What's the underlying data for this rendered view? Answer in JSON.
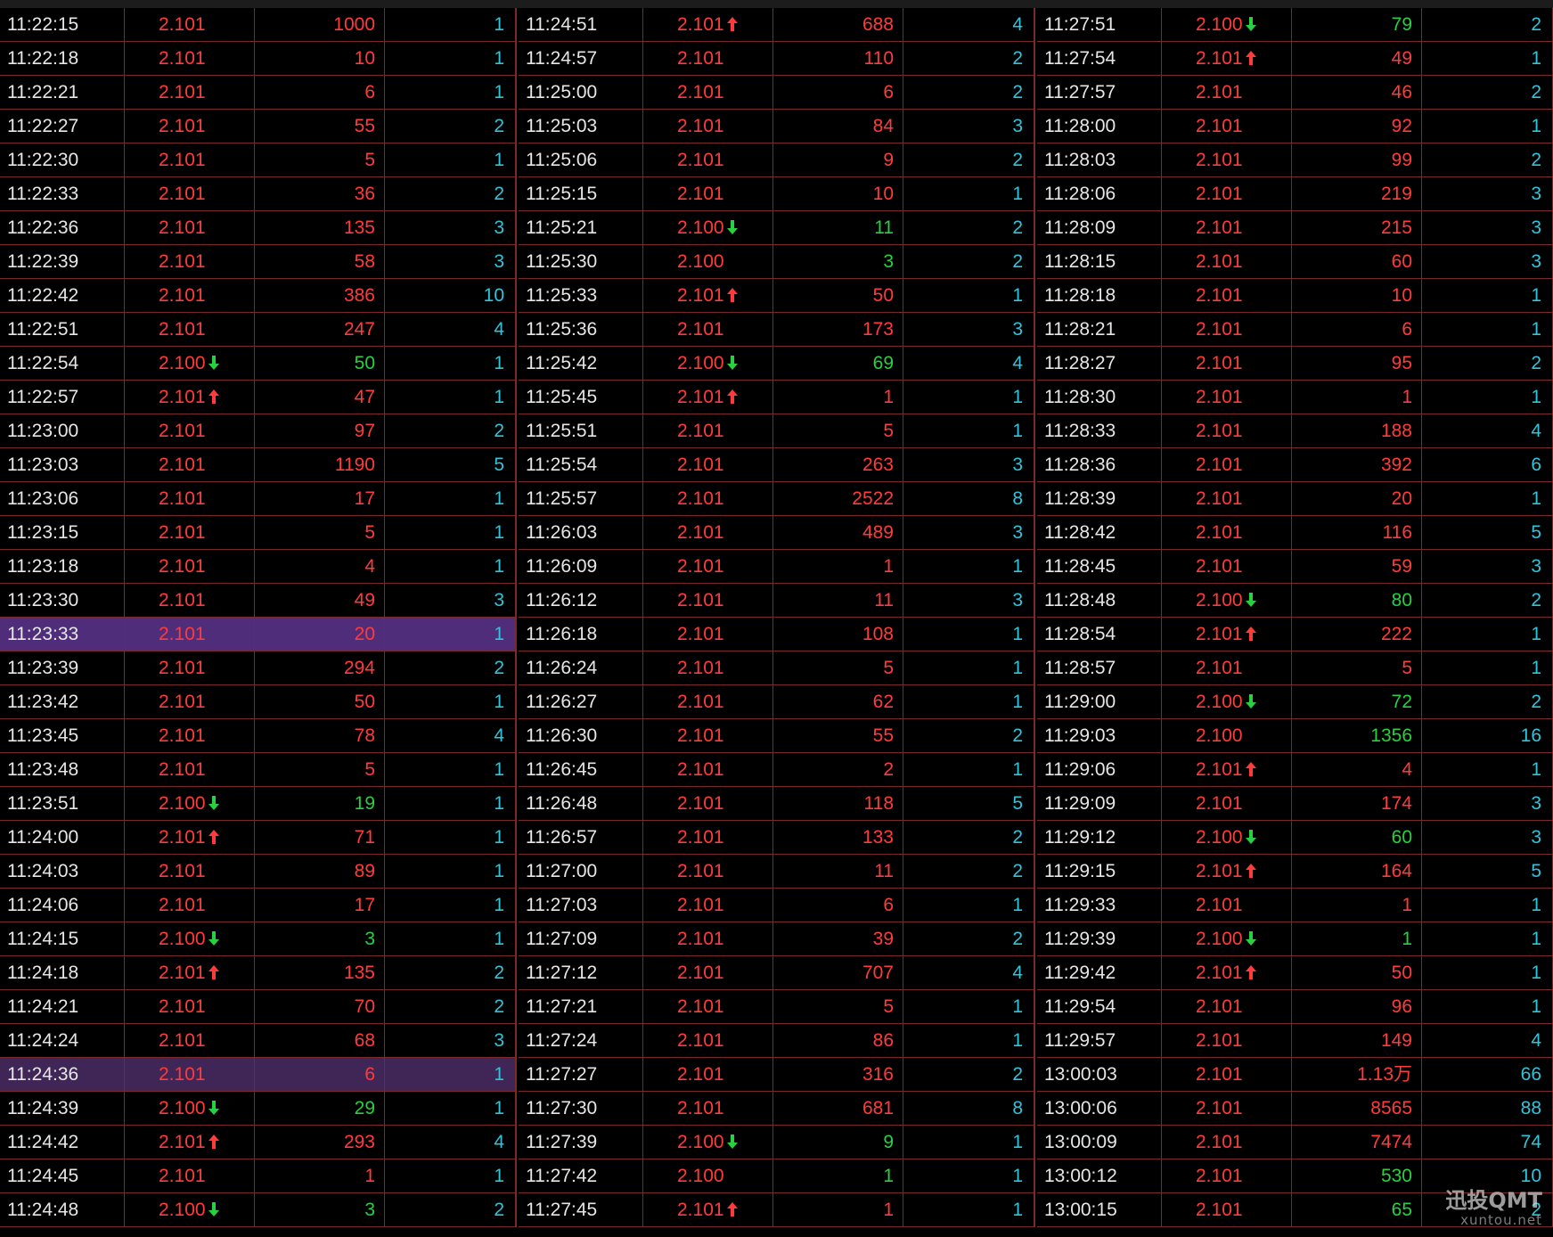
{
  "colors": {
    "up": "#ff3b3b",
    "down": "#27d13f",
    "count": "#2fc4dc",
    "grid": "#7a2a2a",
    "selected_row": "#4f2d7a"
  },
  "watermark": {
    "main": "迅投QMT",
    "sub": "xuntou.net"
  },
  "panels": [
    {
      "rows": [
        {
          "time": "11:22:15",
          "price": "2.101",
          "dir": "",
          "vol": "1000",
          "vol_color": "red",
          "count": "1"
        },
        {
          "time": "11:22:18",
          "price": "2.101",
          "dir": "",
          "vol": "10",
          "vol_color": "red",
          "count": "1"
        },
        {
          "time": "11:22:21",
          "price": "2.101",
          "dir": "",
          "vol": "6",
          "vol_color": "red",
          "count": "1"
        },
        {
          "time": "11:22:27",
          "price": "2.101",
          "dir": "",
          "vol": "55",
          "vol_color": "red",
          "count": "2"
        },
        {
          "time": "11:22:30",
          "price": "2.101",
          "dir": "",
          "vol": "5",
          "vol_color": "red",
          "count": "1"
        },
        {
          "time": "11:22:33",
          "price": "2.101",
          "dir": "",
          "vol": "36",
          "vol_color": "red",
          "count": "2"
        },
        {
          "time": "11:22:36",
          "price": "2.101",
          "dir": "",
          "vol": "135",
          "vol_color": "red",
          "count": "3"
        },
        {
          "time": "11:22:39",
          "price": "2.101",
          "dir": "",
          "vol": "58",
          "vol_color": "red",
          "count": "3"
        },
        {
          "time": "11:22:42",
          "price": "2.101",
          "dir": "",
          "vol": "386",
          "vol_color": "red",
          "count": "10"
        },
        {
          "time": "11:22:51",
          "price": "2.101",
          "dir": "",
          "vol": "247",
          "vol_color": "red",
          "count": "4"
        },
        {
          "time": "11:22:54",
          "price": "2.100",
          "dir": "down",
          "vol": "50",
          "vol_color": "green",
          "count": "1"
        },
        {
          "time": "11:22:57",
          "price": "2.101",
          "dir": "up",
          "vol": "47",
          "vol_color": "red",
          "count": "1"
        },
        {
          "time": "11:23:00",
          "price": "2.101",
          "dir": "",
          "vol": "97",
          "vol_color": "red",
          "count": "2"
        },
        {
          "time": "11:23:03",
          "price": "2.101",
          "dir": "",
          "vol": "1190",
          "vol_color": "red",
          "count": "5"
        },
        {
          "time": "11:23:06",
          "price": "2.101",
          "dir": "",
          "vol": "17",
          "vol_color": "red",
          "count": "1"
        },
        {
          "time": "11:23:15",
          "price": "2.101",
          "dir": "",
          "vol": "5",
          "vol_color": "red",
          "count": "1"
        },
        {
          "time": "11:23:18",
          "price": "2.101",
          "dir": "",
          "vol": "4",
          "vol_color": "red",
          "count": "1"
        },
        {
          "time": "11:23:30",
          "price": "2.101",
          "dir": "",
          "vol": "49",
          "vol_color": "red",
          "count": "3"
        },
        {
          "time": "11:23:33",
          "price": "2.101",
          "dir": "",
          "vol": "20",
          "vol_color": "red",
          "count": "1",
          "sel": "sel"
        },
        {
          "time": "11:23:39",
          "price": "2.101",
          "dir": "",
          "vol": "294",
          "vol_color": "red",
          "count": "2"
        },
        {
          "time": "11:23:42",
          "price": "2.101",
          "dir": "",
          "vol": "50",
          "vol_color": "red",
          "count": "1"
        },
        {
          "time": "11:23:45",
          "price": "2.101",
          "dir": "",
          "vol": "78",
          "vol_color": "red",
          "count": "4"
        },
        {
          "time": "11:23:48",
          "price": "2.101",
          "dir": "",
          "vol": "5",
          "vol_color": "red",
          "count": "1"
        },
        {
          "time": "11:23:51",
          "price": "2.100",
          "dir": "down",
          "vol": "19",
          "vol_color": "green",
          "count": "1"
        },
        {
          "time": "11:24:00",
          "price": "2.101",
          "dir": "up",
          "vol": "71",
          "vol_color": "red",
          "count": "1"
        },
        {
          "time": "11:24:03",
          "price": "2.101",
          "dir": "",
          "vol": "89",
          "vol_color": "red",
          "count": "1"
        },
        {
          "time": "11:24:06",
          "price": "2.101",
          "dir": "",
          "vol": "17",
          "vol_color": "red",
          "count": "1"
        },
        {
          "time": "11:24:15",
          "price": "2.100",
          "dir": "down",
          "vol": "3",
          "vol_color": "green",
          "count": "1"
        },
        {
          "time": "11:24:18",
          "price": "2.101",
          "dir": "up",
          "vol": "135",
          "vol_color": "red",
          "count": "2"
        },
        {
          "time": "11:24:21",
          "price": "2.101",
          "dir": "",
          "vol": "70",
          "vol_color": "red",
          "count": "2"
        },
        {
          "time": "11:24:24",
          "price": "2.101",
          "dir": "",
          "vol": "68",
          "vol_color": "red",
          "count": "3"
        },
        {
          "time": "11:24:36",
          "price": "2.101",
          "dir": "",
          "vol": "6",
          "vol_color": "red",
          "count": "1",
          "sel": "sel2"
        },
        {
          "time": "11:24:39",
          "price": "2.100",
          "dir": "down",
          "vol": "29",
          "vol_color": "green",
          "count": "1"
        },
        {
          "time": "11:24:42",
          "price": "2.101",
          "dir": "up",
          "vol": "293",
          "vol_color": "red",
          "count": "4"
        },
        {
          "time": "11:24:45",
          "price": "2.101",
          "dir": "",
          "vol": "1",
          "vol_color": "red",
          "count": "1"
        },
        {
          "time": "11:24:48",
          "price": "2.100",
          "dir": "down",
          "vol": "3",
          "vol_color": "green",
          "count": "2"
        }
      ]
    },
    {
      "rows": [
        {
          "time": "11:24:51",
          "price": "2.101",
          "dir": "up",
          "vol": "688",
          "vol_color": "red",
          "count": "4"
        },
        {
          "time": "11:24:57",
          "price": "2.101",
          "dir": "",
          "vol": "110",
          "vol_color": "red",
          "count": "2"
        },
        {
          "time": "11:25:00",
          "price": "2.101",
          "dir": "",
          "vol": "6",
          "vol_color": "red",
          "count": "2"
        },
        {
          "time": "11:25:03",
          "price": "2.101",
          "dir": "",
          "vol": "84",
          "vol_color": "red",
          "count": "3"
        },
        {
          "time": "11:25:06",
          "price": "2.101",
          "dir": "",
          "vol": "9",
          "vol_color": "red",
          "count": "2"
        },
        {
          "time": "11:25:15",
          "price": "2.101",
          "dir": "",
          "vol": "10",
          "vol_color": "red",
          "count": "1"
        },
        {
          "time": "11:25:21",
          "price": "2.100",
          "dir": "down",
          "vol": "11",
          "vol_color": "green",
          "count": "2"
        },
        {
          "time": "11:25:30",
          "price": "2.100",
          "dir": "",
          "vol": "3",
          "vol_color": "green",
          "count": "2"
        },
        {
          "time": "11:25:33",
          "price": "2.101",
          "dir": "up",
          "vol": "50",
          "vol_color": "red",
          "count": "1"
        },
        {
          "time": "11:25:36",
          "price": "2.101",
          "dir": "",
          "vol": "173",
          "vol_color": "red",
          "count": "3"
        },
        {
          "time": "11:25:42",
          "price": "2.100",
          "dir": "down",
          "vol": "69",
          "vol_color": "green",
          "count": "4"
        },
        {
          "time": "11:25:45",
          "price": "2.101",
          "dir": "up",
          "vol": "1",
          "vol_color": "red",
          "count": "1"
        },
        {
          "time": "11:25:51",
          "price": "2.101",
          "dir": "",
          "vol": "5",
          "vol_color": "red",
          "count": "1"
        },
        {
          "time": "11:25:54",
          "price": "2.101",
          "dir": "",
          "vol": "263",
          "vol_color": "red",
          "count": "3"
        },
        {
          "time": "11:25:57",
          "price": "2.101",
          "dir": "",
          "vol": "2522",
          "vol_color": "red",
          "count": "8"
        },
        {
          "time": "11:26:03",
          "price": "2.101",
          "dir": "",
          "vol": "489",
          "vol_color": "red",
          "count": "3"
        },
        {
          "time": "11:26:09",
          "price": "2.101",
          "dir": "",
          "vol": "1",
          "vol_color": "red",
          "count": "1"
        },
        {
          "time": "11:26:12",
          "price": "2.101",
          "dir": "",
          "vol": "11",
          "vol_color": "red",
          "count": "3"
        },
        {
          "time": "11:26:18",
          "price": "2.101",
          "dir": "",
          "vol": "108",
          "vol_color": "red",
          "count": "1"
        },
        {
          "time": "11:26:24",
          "price": "2.101",
          "dir": "",
          "vol": "5",
          "vol_color": "red",
          "count": "1"
        },
        {
          "time": "11:26:27",
          "price": "2.101",
          "dir": "",
          "vol": "62",
          "vol_color": "red",
          "count": "1"
        },
        {
          "time": "11:26:30",
          "price": "2.101",
          "dir": "",
          "vol": "55",
          "vol_color": "red",
          "count": "2"
        },
        {
          "time": "11:26:45",
          "price": "2.101",
          "dir": "",
          "vol": "2",
          "vol_color": "red",
          "count": "1"
        },
        {
          "time": "11:26:48",
          "price": "2.101",
          "dir": "",
          "vol": "118",
          "vol_color": "red",
          "count": "5"
        },
        {
          "time": "11:26:57",
          "price": "2.101",
          "dir": "",
          "vol": "133",
          "vol_color": "red",
          "count": "2"
        },
        {
          "time": "11:27:00",
          "price": "2.101",
          "dir": "",
          "vol": "11",
          "vol_color": "red",
          "count": "2"
        },
        {
          "time": "11:27:03",
          "price": "2.101",
          "dir": "",
          "vol": "6",
          "vol_color": "red",
          "count": "1"
        },
        {
          "time": "11:27:09",
          "price": "2.101",
          "dir": "",
          "vol": "39",
          "vol_color": "red",
          "count": "2"
        },
        {
          "time": "11:27:12",
          "price": "2.101",
          "dir": "",
          "vol": "707",
          "vol_color": "red",
          "count": "4"
        },
        {
          "time": "11:27:21",
          "price": "2.101",
          "dir": "",
          "vol": "5",
          "vol_color": "red",
          "count": "1"
        },
        {
          "time": "11:27:24",
          "price": "2.101",
          "dir": "",
          "vol": "86",
          "vol_color": "red",
          "count": "1"
        },
        {
          "time": "11:27:27",
          "price": "2.101",
          "dir": "",
          "vol": "316",
          "vol_color": "red",
          "count": "2"
        },
        {
          "time": "11:27:30",
          "price": "2.101",
          "dir": "",
          "vol": "681",
          "vol_color": "red",
          "count": "8"
        },
        {
          "time": "11:27:39",
          "price": "2.100",
          "dir": "down",
          "vol": "9",
          "vol_color": "green",
          "count": "1"
        },
        {
          "time": "11:27:42",
          "price": "2.100",
          "dir": "",
          "vol": "1",
          "vol_color": "green",
          "count": "1"
        },
        {
          "time": "11:27:45",
          "price": "2.101",
          "dir": "up",
          "vol": "1",
          "vol_color": "red",
          "count": "1"
        }
      ]
    },
    {
      "rows": [
        {
          "time": "11:27:51",
          "price": "2.100",
          "dir": "down",
          "vol": "79",
          "vol_color": "green",
          "count": "2"
        },
        {
          "time": "11:27:54",
          "price": "2.101",
          "dir": "up",
          "vol": "49",
          "vol_color": "red",
          "count": "1"
        },
        {
          "time": "11:27:57",
          "price": "2.101",
          "dir": "",
          "vol": "46",
          "vol_color": "red",
          "count": "2"
        },
        {
          "time": "11:28:00",
          "price": "2.101",
          "dir": "",
          "vol": "92",
          "vol_color": "red",
          "count": "1"
        },
        {
          "time": "11:28:03",
          "price": "2.101",
          "dir": "",
          "vol": "99",
          "vol_color": "red",
          "count": "2"
        },
        {
          "time": "11:28:06",
          "price": "2.101",
          "dir": "",
          "vol": "219",
          "vol_color": "red",
          "count": "3"
        },
        {
          "time": "11:28:09",
          "price": "2.101",
          "dir": "",
          "vol": "215",
          "vol_color": "red",
          "count": "3"
        },
        {
          "time": "11:28:15",
          "price": "2.101",
          "dir": "",
          "vol": "60",
          "vol_color": "red",
          "count": "3"
        },
        {
          "time": "11:28:18",
          "price": "2.101",
          "dir": "",
          "vol": "10",
          "vol_color": "red",
          "count": "1"
        },
        {
          "time": "11:28:21",
          "price": "2.101",
          "dir": "",
          "vol": "6",
          "vol_color": "red",
          "count": "1"
        },
        {
          "time": "11:28:27",
          "price": "2.101",
          "dir": "",
          "vol": "95",
          "vol_color": "red",
          "count": "2"
        },
        {
          "time": "11:28:30",
          "price": "2.101",
          "dir": "",
          "vol": "1",
          "vol_color": "red",
          "count": "1"
        },
        {
          "time": "11:28:33",
          "price": "2.101",
          "dir": "",
          "vol": "188",
          "vol_color": "red",
          "count": "4"
        },
        {
          "time": "11:28:36",
          "price": "2.101",
          "dir": "",
          "vol": "392",
          "vol_color": "red",
          "count": "6"
        },
        {
          "time": "11:28:39",
          "price": "2.101",
          "dir": "",
          "vol": "20",
          "vol_color": "red",
          "count": "1"
        },
        {
          "time": "11:28:42",
          "price": "2.101",
          "dir": "",
          "vol": "116",
          "vol_color": "red",
          "count": "5"
        },
        {
          "time": "11:28:45",
          "price": "2.101",
          "dir": "",
          "vol": "59",
          "vol_color": "red",
          "count": "3"
        },
        {
          "time": "11:28:48",
          "price": "2.100",
          "dir": "down",
          "vol": "80",
          "vol_color": "green",
          "count": "2"
        },
        {
          "time": "11:28:54",
          "price": "2.101",
          "dir": "up",
          "vol": "222",
          "vol_color": "red",
          "count": "1"
        },
        {
          "time": "11:28:57",
          "price": "2.101",
          "dir": "",
          "vol": "5",
          "vol_color": "red",
          "count": "1"
        },
        {
          "time": "11:29:00",
          "price": "2.100",
          "dir": "down",
          "vol": "72",
          "vol_color": "green",
          "count": "2"
        },
        {
          "time": "11:29:03",
          "price": "2.100",
          "dir": "",
          "vol": "1356",
          "vol_color": "green",
          "count": "16"
        },
        {
          "time": "11:29:06",
          "price": "2.101",
          "dir": "up",
          "vol": "4",
          "vol_color": "red",
          "count": "1"
        },
        {
          "time": "11:29:09",
          "price": "2.101",
          "dir": "",
          "vol": "174",
          "vol_color": "red",
          "count": "3"
        },
        {
          "time": "11:29:12",
          "price": "2.100",
          "dir": "down",
          "vol": "60",
          "vol_color": "green",
          "count": "3"
        },
        {
          "time": "11:29:15",
          "price": "2.101",
          "dir": "up",
          "vol": "164",
          "vol_color": "red",
          "count": "5"
        },
        {
          "time": "11:29:33",
          "price": "2.101",
          "dir": "",
          "vol": "1",
          "vol_color": "red",
          "count": "1"
        },
        {
          "time": "11:29:39",
          "price": "2.100",
          "dir": "down",
          "vol": "1",
          "vol_color": "green",
          "count": "1"
        },
        {
          "time": "11:29:42",
          "price": "2.101",
          "dir": "up",
          "vol": "50",
          "vol_color": "red",
          "count": "1"
        },
        {
          "time": "11:29:54",
          "price": "2.101",
          "dir": "",
          "vol": "96",
          "vol_color": "red",
          "count": "1"
        },
        {
          "time": "11:29:57",
          "price": "2.101",
          "dir": "",
          "vol": "149",
          "vol_color": "red",
          "count": "4"
        },
        {
          "time": "13:00:03",
          "price": "2.101",
          "dir": "",
          "vol": "1.13万",
          "vol_color": "red",
          "count": "66"
        },
        {
          "time": "13:00:06",
          "price": "2.101",
          "dir": "",
          "vol": "8565",
          "vol_color": "red",
          "count": "88"
        },
        {
          "time": "13:00:09",
          "price": "2.101",
          "dir": "",
          "vol": "7474",
          "vol_color": "red",
          "count": "74"
        },
        {
          "time": "13:00:12",
          "price": "2.101",
          "dir": "",
          "vol": "530",
          "vol_color": "green",
          "count": "10"
        },
        {
          "time": "13:00:15",
          "price": "2.101",
          "dir": "",
          "vol": "65",
          "vol_color": "green",
          "count": "2"
        }
      ]
    }
  ]
}
